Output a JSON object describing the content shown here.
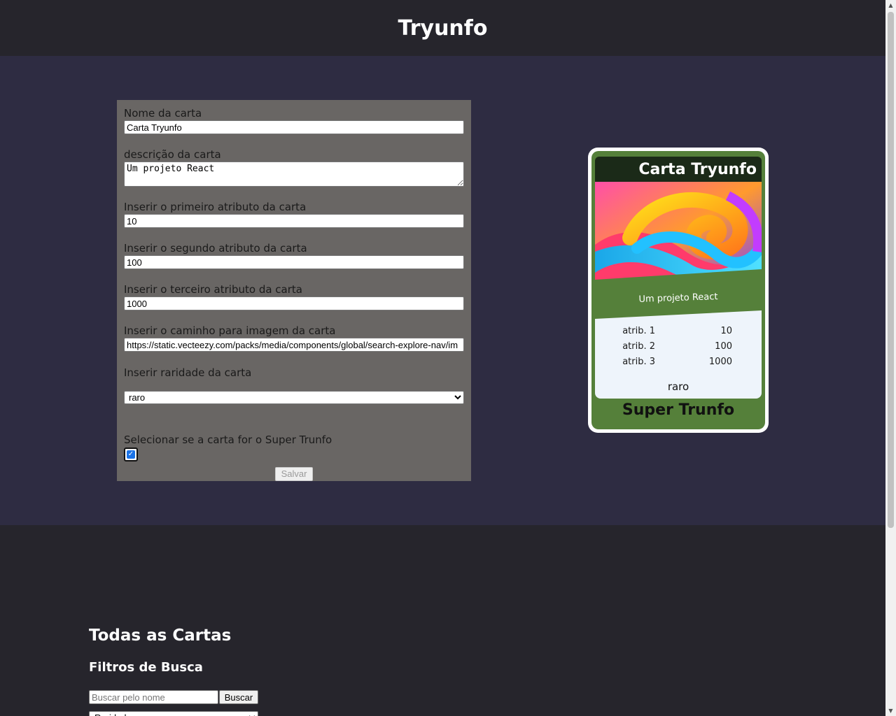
{
  "header": {
    "title": "Tryunfo"
  },
  "form": {
    "name_label": "Nome da carta",
    "name_value": "Carta Tryunfo",
    "description_label": "descrição da carta",
    "description_value": "Um projeto React",
    "attr1_label": "Inserir o primeiro atributo da carta",
    "attr1_value": "10",
    "attr2_label": "Inserir o segundo atributo da carta",
    "attr2_value": "100",
    "attr3_label": "Inserir o terceiro atributo da carta",
    "attr3_value": "1000",
    "image_label": "Inserir o caminho para imagem da carta",
    "image_value": "https://static.vecteezy.com/packs/media/components/global/search-explore-nav/im",
    "rarity_label": "Inserir raridade da carta",
    "rarity_value": "raro",
    "trunfo_label": "Selecionar se a carta for o Super Trunfo",
    "trunfo_checked": true,
    "save_label": "Salvar"
  },
  "preview": {
    "name": "Carta Tryunfo",
    "description": "Um projeto React",
    "attributes": [
      {
        "label": "atrib. 1",
        "value": "10"
      },
      {
        "label": "atrib. 2",
        "value": "100"
      },
      {
        "label": "atrib. 3",
        "value": "1000"
      }
    ],
    "rarity": "raro",
    "trunfo_text": "Super Trunfo"
  },
  "list": {
    "title": "Todas as Cartas",
    "filters_title": "Filtros de Busca",
    "search_placeholder": "Buscar pelo nome",
    "search_button": "Buscar",
    "rarity_filter_value": "Raridade"
  }
}
